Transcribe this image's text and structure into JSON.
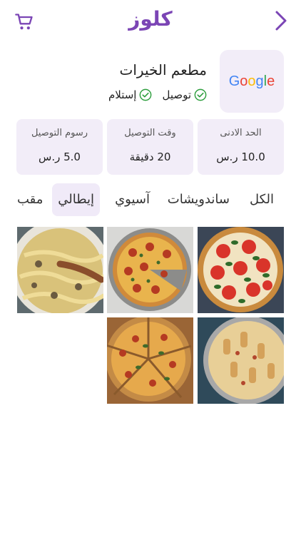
{
  "header": {
    "title": "كلوز"
  },
  "restaurant": {
    "name": "مطعم الخيرات",
    "logo_text": "Google",
    "options": [
      "توصيل",
      "إستلام"
    ]
  },
  "stats": [
    {
      "label": "الحد الادنى",
      "value": "10.0 ر.س"
    },
    {
      "label": "وقت التوصيل",
      "value": "20 دقيقة"
    },
    {
      "label": "رسوم التوصيل",
      "value": "5.0 ر.س"
    }
  ],
  "tabs": [
    {
      "label": "الكل"
    },
    {
      "label": "ساندويشات"
    },
    {
      "label": "آسيوي"
    },
    {
      "label": "إيطالي",
      "selected": true
    },
    {
      "label": "مقب"
    }
  ],
  "products": [
    {
      "icon": "margherita-pizza-image"
    },
    {
      "icon": "pepperoni-pizza-image"
    },
    {
      "icon": "pasta-mushroom-image"
    },
    {
      "icon": "baked-pasta-image"
    },
    {
      "icon": "pizza-slices-image"
    }
  ],
  "colors": {
    "brand": "#7b45b5",
    "card_bg": "#f2edf8",
    "check": "#2e9e3e"
  }
}
